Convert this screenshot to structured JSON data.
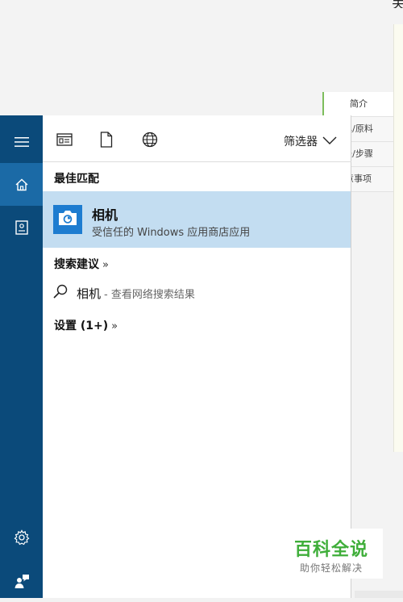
{
  "background_page": {
    "nav_items": [
      {
        "label": "简介",
        "active": true
      },
      {
        "label": "具/原料",
        "active": false
      },
      {
        "label": "法/步骤",
        "active": false
      },
      {
        "label": "意事项",
        "active": false
      }
    ]
  },
  "rail": {
    "items": [
      "hamburger-icon",
      "home-icon",
      "notebook-icon"
    ],
    "bottom": [
      "gear-icon",
      "feedback-icon"
    ],
    "active": "home-icon",
    "colors": {
      "rail_bg": "#0b4a7a",
      "active_bg": "#1b6aa6"
    }
  },
  "toolbar": {
    "filter_types": [
      "apps-filter-icon",
      "documents-filter-icon",
      "web-filter-icon"
    ],
    "filter_label": "筛选器"
  },
  "results": {
    "best_match_header": "最佳匹配",
    "best_match": {
      "name": "相机",
      "description": "受信任的 Windows 应用商店应用",
      "icon": "camera-icon",
      "highlight_color": "#c3ddf1",
      "icon_color": "#1d7cd0"
    },
    "suggestions_header": "搜索建议",
    "suggestions_chevron": "»",
    "suggestion": {
      "term": "相机",
      "description": "- 查看网络搜索结果"
    },
    "settings_header": "设置 (1+)",
    "settings_chevron": "»"
  },
  "watermark": {
    "title": "百科全说",
    "subtitle": "助你轻松解决",
    "color": "#3fae3a"
  }
}
